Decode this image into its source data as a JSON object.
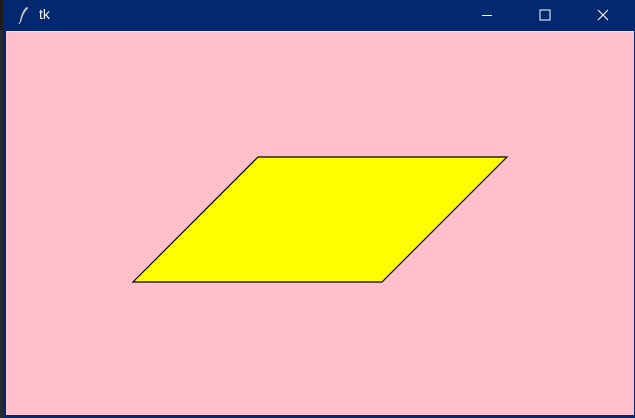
{
  "window": {
    "title": "tk",
    "icon": "tk-feather-icon",
    "controls": [
      "minimize-icon",
      "maximize-icon",
      "close-icon"
    ],
    "titlebar_color": "#03286f"
  },
  "canvas": {
    "background_color": "#ffc0cb",
    "shape": {
      "type": "parallelogram",
      "fill_color": "#ffff00",
      "outline_color": "#000000"
    }
  }
}
